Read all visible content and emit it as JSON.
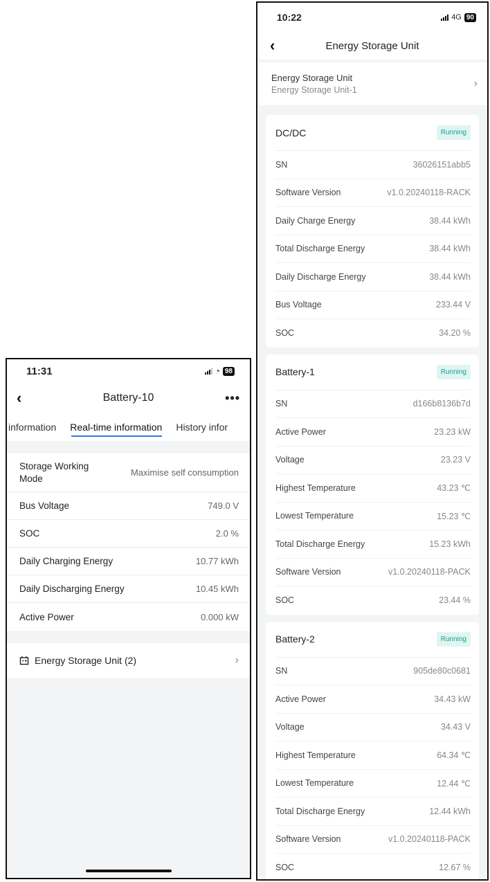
{
  "left": {
    "status": {
      "time": "11:31",
      "battery": "98"
    },
    "title": "Battery-10",
    "more": "•••",
    "tabs": [
      "information",
      "Real-time information",
      "History infor"
    ],
    "rows": [
      {
        "label": "Storage Working Mode",
        "value": "Maximise self consumption"
      },
      {
        "label": "Bus Voltage",
        "value": "749.0 V"
      },
      {
        "label": "SOC",
        "value": "2.0 %"
      },
      {
        "label": "Daily Charging Energy",
        "value": "10.77 kWh"
      },
      {
        "label": "Daily Discharging Energy",
        "value": "10.45 kWh"
      },
      {
        "label": "Active Power",
        "value": "0.000 kW"
      }
    ],
    "esu_link": "Energy Storage Unit (2)"
  },
  "right": {
    "status": {
      "time": "10:22",
      "network": "4G",
      "battery": "90"
    },
    "title": "Energy Storage Unit",
    "unit_selector": {
      "label": "Energy Storage Unit",
      "value": "Energy Storage Unit-1"
    },
    "cards": [
      {
        "title": "DC/DC",
        "status": "Running",
        "rows": [
          {
            "label": "SN",
            "value": "36026151abb5"
          },
          {
            "label": "Software Version",
            "value": "v1.0.20240118-RACK"
          },
          {
            "label": "Daily Charge Energy",
            "value": "38.44 kWh"
          },
          {
            "label": "Total Discharge Energy",
            "value": "38.44 kWh"
          },
          {
            "label": "Daily Discharge Energy",
            "value": "38.44 kWh"
          },
          {
            "label": "Bus Voltage",
            "value": "233.44 V"
          },
          {
            "label": "SOC",
            "value": "34.20 %"
          }
        ]
      },
      {
        "title": "Battery-1",
        "status": "Running",
        "rows": [
          {
            "label": "SN",
            "value": "d166b8136b7d"
          },
          {
            "label": "Active Power",
            "value": "23.23 kW"
          },
          {
            "label": "Voltage",
            "value": "23.23 V"
          },
          {
            "label": "Highest Temperature",
            "value": "43.23 ℃"
          },
          {
            "label": "Lowest Temperature",
            "value": "15.23 ℃"
          },
          {
            "label": "Total Discharge Energy",
            "value": "15.23 kWh"
          },
          {
            "label": "Software Version",
            "value": "v1.0.20240118-PACK"
          },
          {
            "label": "SOC",
            "value": "23.44 %"
          }
        ]
      },
      {
        "title": "Battery-2",
        "status": "Running",
        "rows": [
          {
            "label": "SN",
            "value": "905de80c0681"
          },
          {
            "label": "Active Power",
            "value": "34.43 kW"
          },
          {
            "label": "Voltage",
            "value": "34.43 V"
          },
          {
            "label": "Highest Temperature",
            "value": "64.34 ℃"
          },
          {
            "label": "Lowest Temperature",
            "value": "12.44 ℃"
          },
          {
            "label": "Total Discharge Energy",
            "value": "12.44 kWh"
          },
          {
            "label": "Software Version",
            "value": "v1.0.20240118-PACK"
          },
          {
            "label": "SOC",
            "value": "12.67 %"
          }
        ]
      }
    ]
  }
}
